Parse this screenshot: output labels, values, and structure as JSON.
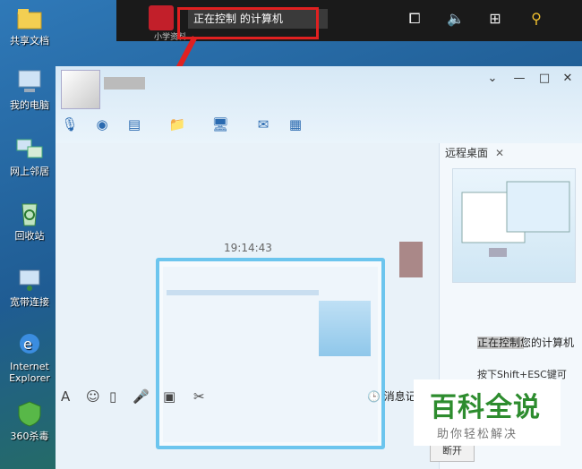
{
  "desktop": {
    "icons": [
      {
        "label": "共享文档",
        "icon": "folder-shared-icon"
      },
      {
        "label": "我的电脑",
        "icon": "computer-icon"
      },
      {
        "label": "网上邻居",
        "icon": "network-icon"
      },
      {
        "label": "回收站",
        "icon": "recycle-bin-icon"
      },
      {
        "label": "宽带连接",
        "icon": "broadband-icon"
      },
      {
        "label": "Internet Explorer",
        "icon": "ie-icon"
      },
      {
        "label": "360杀毒",
        "icon": "antivirus-icon"
      }
    ]
  },
  "topbar": {
    "app_caption": "小学资料",
    "title": "正在控制 的计算机"
  },
  "chat": {
    "timestamp": "19:14:43",
    "message_record": "消息记"
  },
  "remote_panel": {
    "tab_title": "远程桌面",
    "description": "正在控制您的计算机",
    "hint": "按下Shift+ESC键可以停",
    "accept_button": "断开"
  },
  "watermark": {
    "title": "百科全说",
    "subtitle": "助你轻松解决"
  }
}
